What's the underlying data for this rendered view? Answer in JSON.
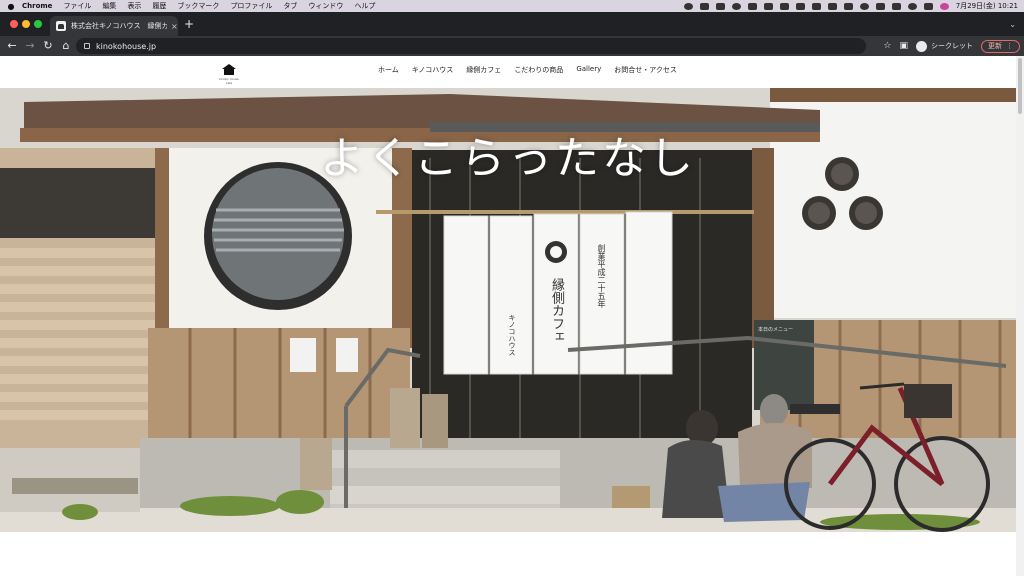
{
  "menubar": {
    "app": "Chrome",
    "items": [
      "ファイル",
      "編集",
      "表示",
      "履歴",
      "ブックマーク",
      "プロファイル",
      "タブ",
      "ウィンドウ",
      "ヘルプ"
    ],
    "clock": "7月29日(金) 10:21"
  },
  "browser": {
    "tab_title": "株式会社キノコハウス　縁側カフェ",
    "tab_close": "×",
    "new_tab": "+",
    "url": "kinokohouse.jp",
    "incognito_label": "シークレット",
    "update_label": "更新"
  },
  "site": {
    "logo_sub": "kinoko house cafe",
    "nav": [
      "ホーム",
      "キノコハウス",
      "縁側カフェ",
      "こだわりの商品",
      "Gallery",
      "お問合せ・アクセス"
    ],
    "hero_title": "よくこらったなし",
    "noren": {
      "left": "キノコハウス",
      "center": "縁側カフェ",
      "right": "創業平成二十五年"
    },
    "chalkboard": "本日のメニュー"
  },
  "colors": {
    "menubar_bg": "#d9d4df",
    "tabstrip_bg": "#202124",
    "toolbar_bg": "#35363a",
    "update_border": "#e46962"
  }
}
